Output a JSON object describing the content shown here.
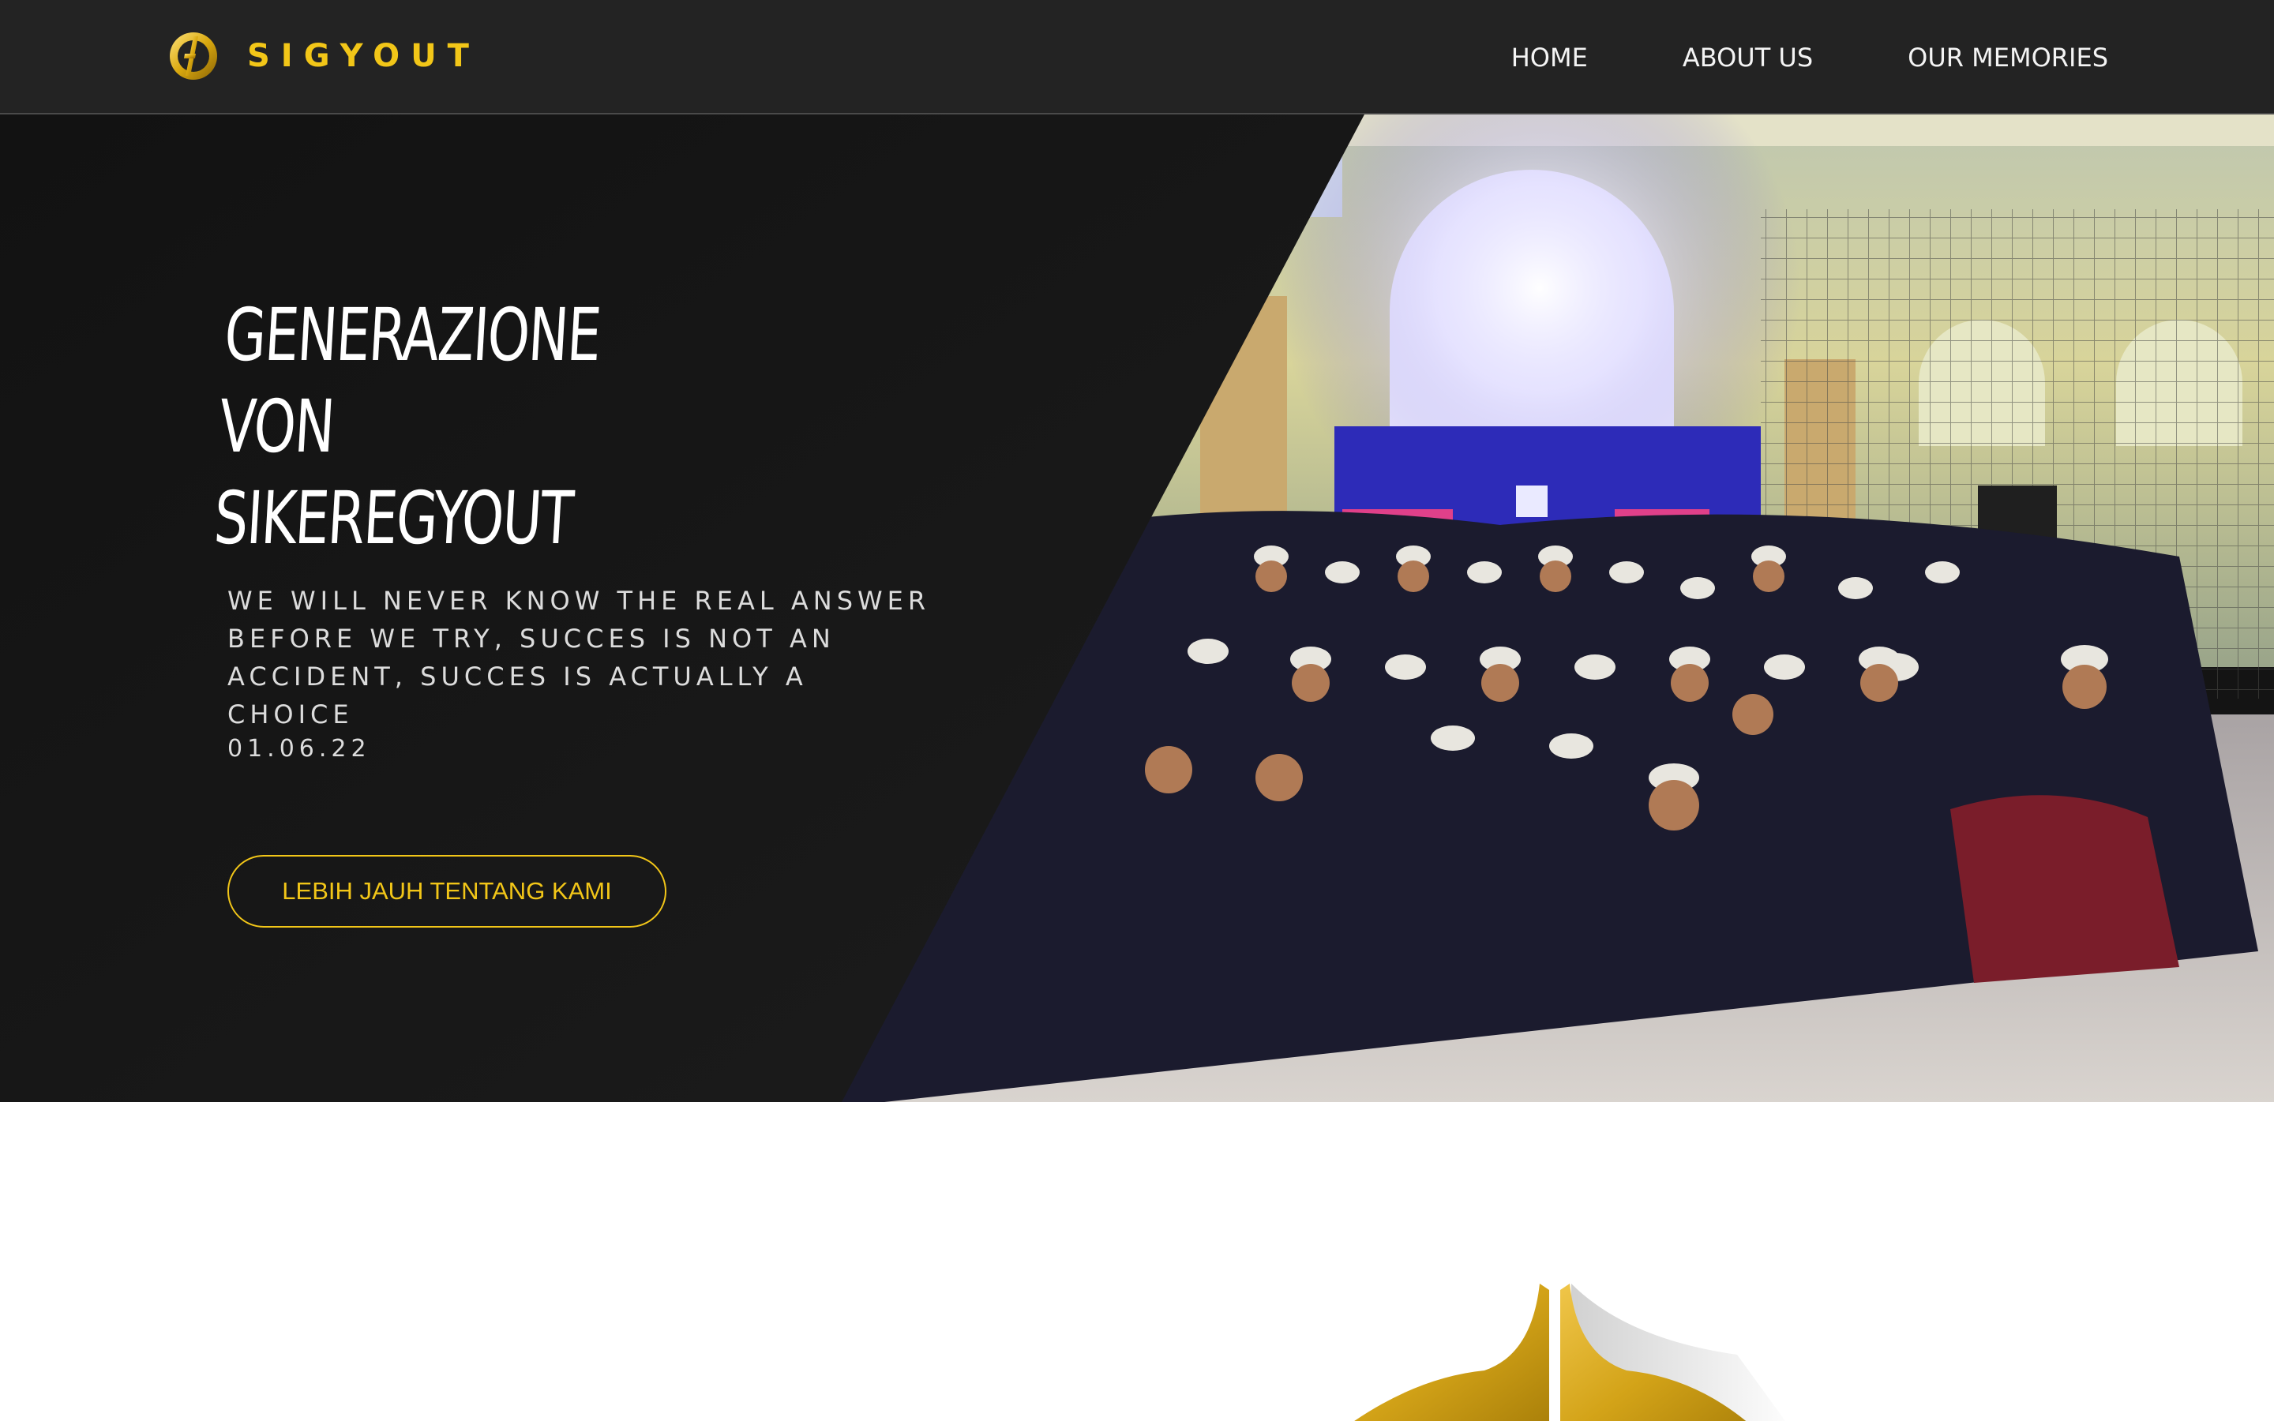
{
  "brand": {
    "name": "SIGYOUT",
    "logo_icon": "sigyout-logo-icon",
    "accent_color": "#f2c618"
  },
  "nav": {
    "items": [
      {
        "label": "HOME"
      },
      {
        "label": "ABOUT US"
      },
      {
        "label": "OUR MEMORIES"
      }
    ]
  },
  "hero": {
    "title_lines": [
      "GENERAZIONE",
      "VON",
      "SIKEREGYOUT"
    ],
    "text": "WE WILL NEVER KNOW THE REAL ANSWER BEFORE WE TRY, SUCCES IS NOT AN ACCIDENT, SUCCES IS ACTUALLY A CHOICE",
    "date": "01.06.22",
    "button_label": "LEBIH JAUH TENTANG KAMI",
    "photo_name": "group-photo"
  },
  "lower": {
    "emblem_icon": "gold-emblem-icon"
  }
}
